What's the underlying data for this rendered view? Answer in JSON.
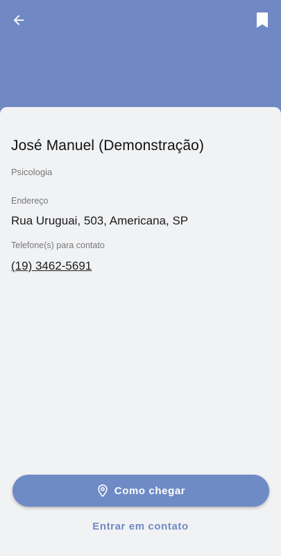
{
  "header": {
    "back_icon": "arrow-left-icon",
    "bookmark_icon": "bookmark-icon",
    "background_color": "#7088c4"
  },
  "professional": {
    "name": "José Manuel (Demonstração)",
    "specialty": "Psicologia"
  },
  "address": {
    "label": "Endereço",
    "value": "Rua Uruguai, 503, Americana, SP"
  },
  "phone": {
    "label": "Telefone(s) para contato",
    "value": "(19) 3462-5691"
  },
  "actions": {
    "directions_label": "Como chegar",
    "directions_icon": "map-pin-icon",
    "contact_label": "Entrar em contato"
  },
  "colors": {
    "accent": "#7088c4",
    "card_background": "#f1f2f4"
  }
}
